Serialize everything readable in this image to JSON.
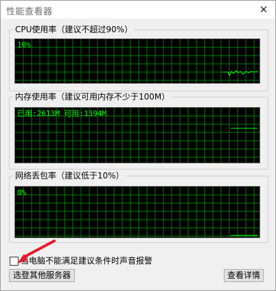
{
  "window": {
    "title": "性能查看器",
    "close_glyph": "✕"
  },
  "cpu": {
    "legend": "CPU使用率（建议不超过90%）",
    "readout": "10%"
  },
  "memory": {
    "legend": "内存使用率（建议可用内存不少于100M）",
    "readout": "已用:2613M 可用:1394M"
  },
  "network": {
    "legend": "网络丢包率（建议低于10%）",
    "readout": "0%"
  },
  "alarm": {
    "label": "当电脑不能满足建议条件时声音报警",
    "checked": false
  },
  "buttons": {
    "select_server": "选登其他服务器",
    "details": "查看详情"
  },
  "colors": {
    "grid": "#008000",
    "trace": "#00ff00",
    "monitor_bg": "#000000",
    "annotation_arrow": "#e8192c"
  }
}
